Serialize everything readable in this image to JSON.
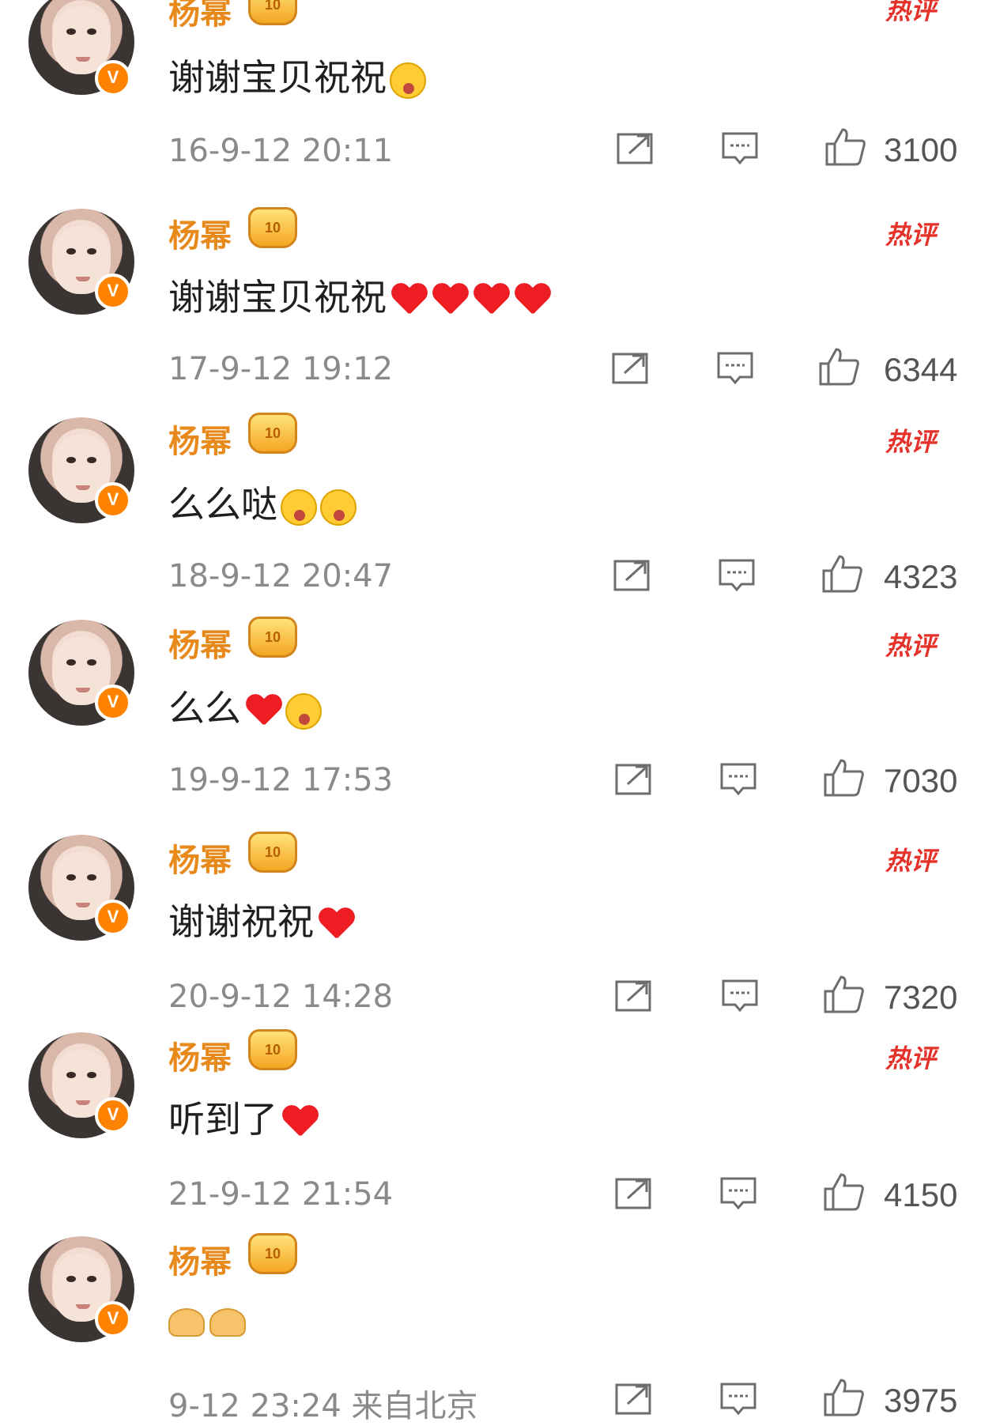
{
  "comments": [
    {
      "user": "杨幂",
      "hot_label": "热评",
      "text": "谢谢宝贝祝祝",
      "emoji": [
        "kiss-face"
      ],
      "time": "16-9-12 20:11",
      "likes": "3100"
    },
    {
      "user": "杨幂",
      "hot_label": "热评",
      "text": "谢谢宝贝祝祝",
      "emoji": [
        "heart",
        "heart",
        "heart",
        "heart"
      ],
      "time": "17-9-12 19:12",
      "likes": "6344"
    },
    {
      "user": "杨幂",
      "hot_label": "热评",
      "text": "么么哒",
      "emoji": [
        "scream-face",
        "scream-face"
      ],
      "time": "18-9-12 20:47",
      "likes": "4323"
    },
    {
      "user": "杨幂",
      "hot_label": "热评",
      "text": "么么",
      "emoji": [
        "heart",
        "kiss-face"
      ],
      "time": "19-9-12 17:53",
      "likes": "7030"
    },
    {
      "user": "杨幂",
      "hot_label": "热评",
      "text": "谢谢祝祝",
      "emoji": [
        "heart"
      ],
      "time": "20-9-12 14:28",
      "likes": "7320"
    },
    {
      "user": "杨幂",
      "hot_label": "热评",
      "text": "听到了",
      "emoji": [
        "heart"
      ],
      "time": "21-9-12 21:54",
      "likes": "4150"
    },
    {
      "user": "杨幂",
      "hot_label": "",
      "text": "",
      "emoji": [
        "pray",
        "pray"
      ],
      "time": "9-12 23:24  来自北京",
      "likes": "3975"
    }
  ],
  "badges": {
    "verified": "V",
    "member_level": "10"
  },
  "colors": {
    "name": "#e8891b",
    "hot": "#e4312a",
    "verified": "#ff8200",
    "heart": "#ee1d24"
  }
}
